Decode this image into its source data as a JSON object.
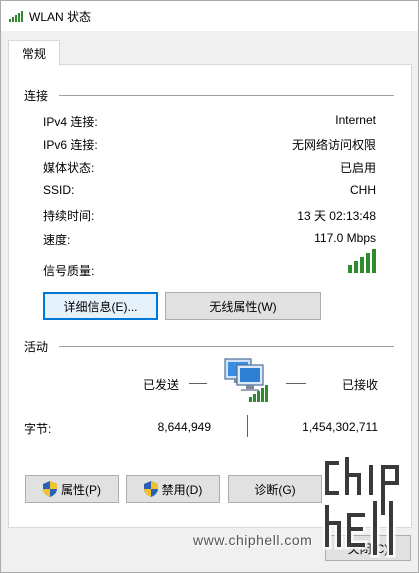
{
  "window": {
    "title": "WLAN 状态",
    "title_icon": "wifi-signal-icon"
  },
  "tabs": [
    {
      "label": "常规",
      "selected": true
    }
  ],
  "connection": {
    "section_title": "连接",
    "rows": [
      {
        "label": "IPv4 连接:",
        "value": "Internet"
      },
      {
        "label": "IPv6 连接:",
        "value": "无网络访问权限"
      },
      {
        "label": "媒体状态:",
        "value": "已启用"
      },
      {
        "label": "SSID:",
        "value": "CHH"
      },
      {
        "label": "持续时间:",
        "value": "13 天 02:13:48"
      },
      {
        "label": "速度:",
        "value": "117.0 Mbps"
      }
    ],
    "signal_label": "信号质量:",
    "signal_bars": 5,
    "signal_bars_filled": 5,
    "signal_color": "#2e8b2e",
    "details_button": "详细信息(E)...",
    "wireless_props_button": "无线属性(W)"
  },
  "activity": {
    "section_title": "活动",
    "sent_label": "已发送",
    "received_label": "已接收",
    "bytes_label": "字节:",
    "bytes_sent": "8,644,949",
    "bytes_received": "1,454,302,711",
    "network_icon": "computer-network-icon"
  },
  "buttons": {
    "properties": "属性(P)",
    "disable": "禁用(D)",
    "diagnose": "诊断(G)",
    "close": "关闭(C)"
  },
  "overlay": {
    "watermark": "www.chiphell.com",
    "logo": "chiphell-logo"
  },
  "colors": {
    "accent": "#0078d7",
    "shield_blue": "#2b5fb4",
    "shield_yellow": "#f2c12e"
  }
}
